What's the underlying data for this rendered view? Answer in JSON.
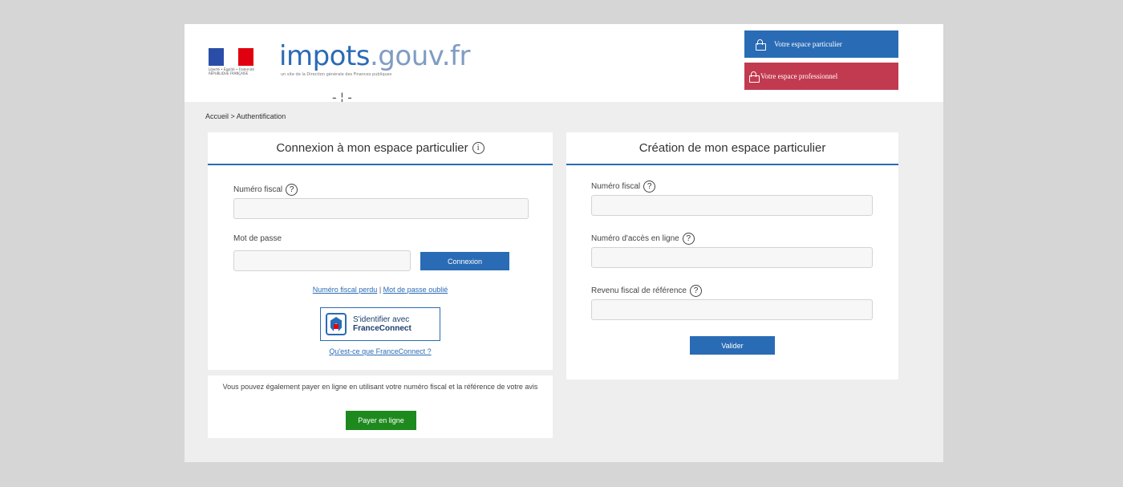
{
  "header": {
    "logo_main": "impots",
    "logo_domain": ".gouv.fr",
    "logo_subtitle": "un site de la Direction générale des Finances publiques",
    "rf_label": "Liberté • Égalité • Fraternité RÉPUBLIQUE FRANÇAISE",
    "btn_particulier": "Votre espace particulier",
    "btn_professionnel": "Votre espace professionnel",
    "colors": {
      "particulier": "#2a6bb5",
      "professionnel": "#c23a50"
    }
  },
  "breadcrumb": "Accueil > Authentification",
  "login": {
    "title": "Connexion à mon espace particulier",
    "info_icon": "i",
    "numero_fiscal_label": "Numéro fiscal",
    "numero_fiscal_value": "",
    "password_label": "Mot de passe",
    "password_value": "",
    "connect_button": "Connexion",
    "lost_fiscal_link": "Numéro fiscal perdu",
    "separator": " | ",
    "forgot_password_link": "Mot de passe oublié",
    "fc_line1": "S'identifier avec",
    "fc_line2": "FranceConnect",
    "fc_what_link": "Qu'est-ce que FranceConnect ?"
  },
  "payment": {
    "text": "Vous pouvez également payer en ligne en utilisant votre numéro fiscal et la référence de votre avis",
    "button": "Payer en ligne"
  },
  "create": {
    "title": "Création de mon espace particulier",
    "numero_fiscal_label": "Numéro fiscal",
    "access_number_label": "Numéro d'accès en ligne",
    "revenue_label": "Revenu fiscal de référence",
    "validate_button": "Valider"
  },
  "help_icon": "?"
}
